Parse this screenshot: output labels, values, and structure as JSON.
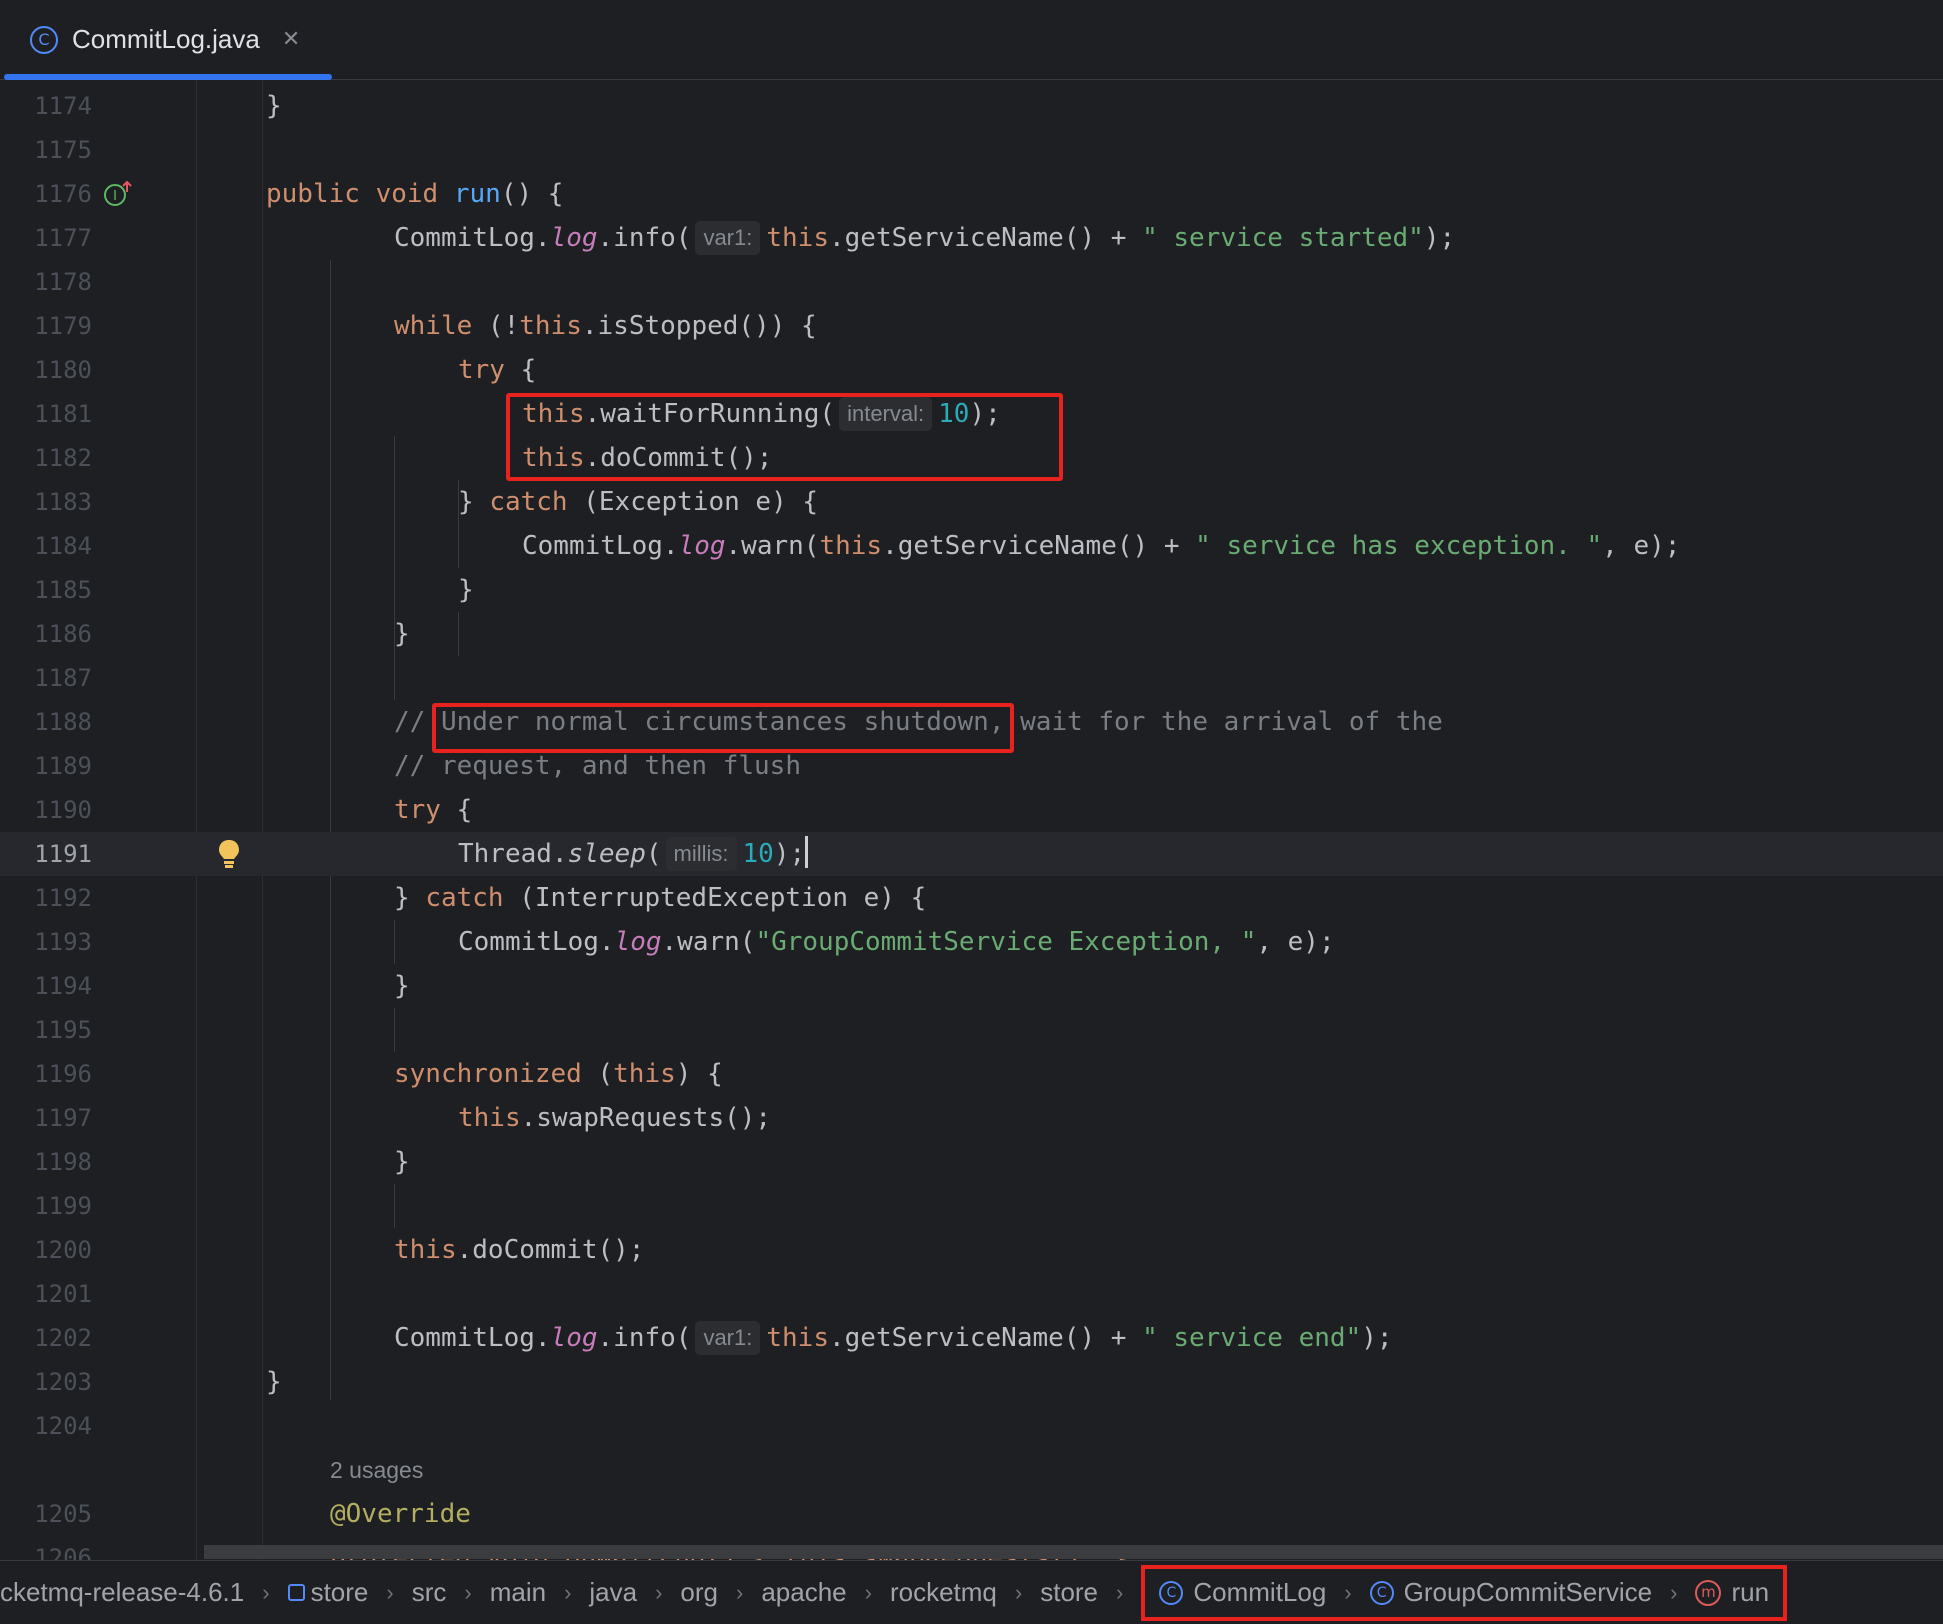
{
  "tab": {
    "label": "CommitLog.java",
    "icon": "class-icon",
    "close_icon": "close-icon"
  },
  "colors": {
    "accent": "#3574f0",
    "highlight_box": "#e8231f",
    "background": "#1e1f22"
  },
  "editor": {
    "line_numbers": [
      "1174",
      "1175",
      "1176",
      "1177",
      "1178",
      "1179",
      "1180",
      "1181",
      "1182",
      "1183",
      "1184",
      "1185",
      "1186",
      "1187",
      "1188",
      "1189",
      "1190",
      "1191",
      "1192",
      "1193",
      "1194",
      "1195",
      "1196",
      "1197",
      "1198",
      "1199",
      "1200",
      "1201",
      "1202",
      "1203",
      "1204",
      "1205",
      "1206"
    ],
    "current_line": "1191",
    "code": {
      "l1174_brace": "}",
      "l1176_public": "public",
      "l1176_void": "void",
      "l1176_run": "run",
      "l1176_rest": "() {",
      "l1177_pre": "CommitLog.",
      "l1177_log": "log",
      "l1177_info": ".info(",
      "l1177_hint": "var1:",
      "l1177_this": "this",
      "l1177_mid": ".getServiceName() + ",
      "l1177_str": "\" service started\"",
      "l1177_end": ");",
      "l1179_while": "while",
      "l1179_mid1": " (!",
      "l1179_this": "this",
      "l1179_rest": ".isStopped()) {",
      "l1180_try": "try",
      "l1180_rest": " {",
      "l1181_this": "this",
      "l1181_mid": ".waitForRunning(",
      "l1181_hint": "interval:",
      "l1181_num": "10",
      "l1181_end": ");",
      "l1182_this": "this",
      "l1182_rest": ".doCommit();",
      "l1183_pre": "} ",
      "l1183_catch": "catch",
      "l1183_rest": " (Exception e) {",
      "l1184_pre": "CommitLog.",
      "l1184_log": "log",
      "l1184_warn": ".warn(",
      "l1184_this": "this",
      "l1184_mid": ".getServiceName() + ",
      "l1184_str": "\" service has exception. \"",
      "l1184_end": ", e);",
      "l1185_brace": "}",
      "l1186_brace": "}",
      "l1188_comment": "// Under normal circumstances shutdown, wait for the arrival of the",
      "l1189_comment": "// request, and then flush",
      "l1190_try": "try",
      "l1190_rest": " {",
      "l1191_pre": "Thread.",
      "l1191_sleep": "sleep",
      "l1191_paren": "(",
      "l1191_hint": "millis:",
      "l1191_num": "10",
      "l1191_end": ");",
      "l1192_pre": "} ",
      "l1192_catch": "catch",
      "l1192_rest": " (InterruptedException e) {",
      "l1193_pre": "CommitLog.",
      "l1193_log": "log",
      "l1193_warn": ".warn(",
      "l1193_str": "\"GroupCommitService Exception, \"",
      "l1193_end": ", e);",
      "l1194_brace": "}",
      "l1196_sync": "synchronized",
      "l1196_mid": " (",
      "l1196_this": "this",
      "l1196_rest": ") {",
      "l1197_this": "this",
      "l1197_rest": ".swapRequests();",
      "l1198_brace": "}",
      "l1200_this": "this",
      "l1200_rest": ".doCommit();",
      "l1202_pre": "CommitLog.",
      "l1202_log": "log",
      "l1202_info": ".info(",
      "l1202_hint": "var1:",
      "l1202_this": "this",
      "l1202_mid": ".getServiceName() + ",
      "l1202_str": "\" service end\"",
      "l1202_end": ");",
      "l1203_brace": "}",
      "usages": "2 usages",
      "l1205_ann": "@Override",
      "l1206_partial": "protected void onWaitEnd() { this.swapRequests(); }"
    }
  },
  "breadcrumbs": {
    "items": [
      "cketmq-release-4.6.1",
      "store",
      "src",
      "main",
      "java",
      "org",
      "apache",
      "rocketmq",
      "store",
      "CommitLog",
      "GroupCommitService",
      "run"
    ],
    "separator": "›",
    "icons": {
      "module": "module-icon",
      "class": "class-icon",
      "method": "method-icon"
    }
  },
  "gutter": {
    "implements_marker": "implements-method-icon",
    "intention_bulb": "lightbulb-icon"
  }
}
